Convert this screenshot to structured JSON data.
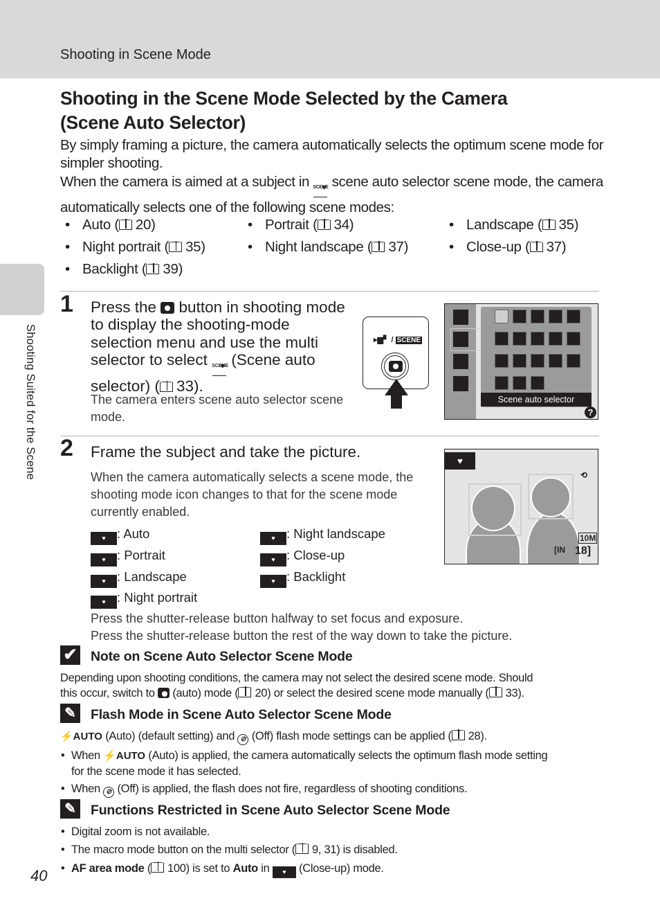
{
  "header": {
    "section": "Shooting in Scene Mode"
  },
  "side_tab": {
    "label": "Shooting Suited for the Scene"
  },
  "page_number": "40",
  "title": {
    "line1": "Shooting in the Scene Mode Selected by the Camera",
    "line2": "(Scene Auto Selector)"
  },
  "intro": {
    "p1": "By simply framing a picture, the camera automatically selects the optimum scene mode for simpler shooting.",
    "p2_before": "When the camera is aimed at a subject in ",
    "p2_after": " scene auto selector scene mode, the camera automatically selects one of the following scene modes:"
  },
  "scene_modes": [
    {
      "label": "Auto (",
      "page": "20)"
    },
    {
      "label": "Portrait (",
      "page": "34)"
    },
    {
      "label": "Landscape (",
      "page": "35)"
    },
    {
      "label": "Night portrait (",
      "page": "35)"
    },
    {
      "label": "Night landscape (",
      "page": "37)"
    },
    {
      "label": "Close-up (",
      "page": "37)"
    },
    {
      "label": "Backlight (",
      "page": "39)"
    }
  ],
  "step1": {
    "number": "1",
    "text_a": "Press the ",
    "text_b": " button in shooting mode to display the shooting-mode selection menu and use the multi selector to select ",
    "text_c": " (Scene auto selector) (",
    "text_d": "33).",
    "sub": "The camera enters scene auto selector scene mode.",
    "button_label_icon": "movie-icon",
    "button_label_text": "SCENE",
    "screen_caption": "Scene auto selector",
    "help_glyph": "?"
  },
  "step2": {
    "number": "2",
    "heading": "Frame the subject and take the picture.",
    "sub": "When the camera automatically selects a scene mode, the shooting mode icon changes to that for the scene mode currently enabled.",
    "legend": [
      {
        "icon": "scene-auto-icon",
        "label": ": Auto"
      },
      {
        "icon": "portrait-icon",
        "label": ": Portrait"
      },
      {
        "icon": "landscape-icon",
        "label": ": Landscape"
      },
      {
        "icon": "night-portrait-icon",
        "label": ": Night portrait"
      },
      {
        "icon": "night-landscape-icon",
        "label": ": Night landscape"
      },
      {
        "icon": "close-up-icon",
        "label": ": Close-up"
      },
      {
        "icon": "backlight-icon",
        "label": ": Backlight"
      }
    ],
    "press1": "Press the shutter-release button halfway to set focus and exposure.",
    "press2": "Press the shutter-release button the rest of the way down to take the picture.",
    "screen_image_size": "10M",
    "screen_memory": "IN",
    "screen_remaining": "18"
  },
  "note": {
    "heading": "Note on Scene Auto Selector Scene Mode",
    "line1": "Depending upon shooting conditions, the camera may not select the desired scene mode. Should",
    "line2_a": "this occur, switch to ",
    "line2_b": " (auto) mode (",
    "line2_c": "20) or select the desired scene mode manually (",
    "line2_d": "33)."
  },
  "flash": {
    "heading": "Flash Mode in Scene Auto Selector Scene Mode",
    "auto_glyph": "⚡AUTO",
    "off_glyph": "⊘",
    "intro_a": " (Auto) (default setting) and ",
    "intro_b": " (Off) flash mode settings can be applied (",
    "intro_c": "28).",
    "b1_a": "When ",
    "b1_b": " (Auto) is applied, the camera automatically selects the optimum flash mode setting",
    "b1_c": "for the scene mode it has selected.",
    "b2_a": "When ",
    "b2_b": " (Off) is applied, the flash does not fire, regardless of shooting conditions."
  },
  "restricted": {
    "heading": "Functions Restricted in Scene Auto Selector Scene Mode",
    "b1": "Digital zoom is not available.",
    "b2_a": "The macro mode button on the multi selector (",
    "b2_b": "9, 31) is disabled.",
    "b3_bold1": "AF area mode",
    "b3_a": " (",
    "b3_b": "100) is set to ",
    "b3_bold2": "Auto",
    "b3_c": " in ",
    "b3_d": " (Close-up) mode."
  }
}
